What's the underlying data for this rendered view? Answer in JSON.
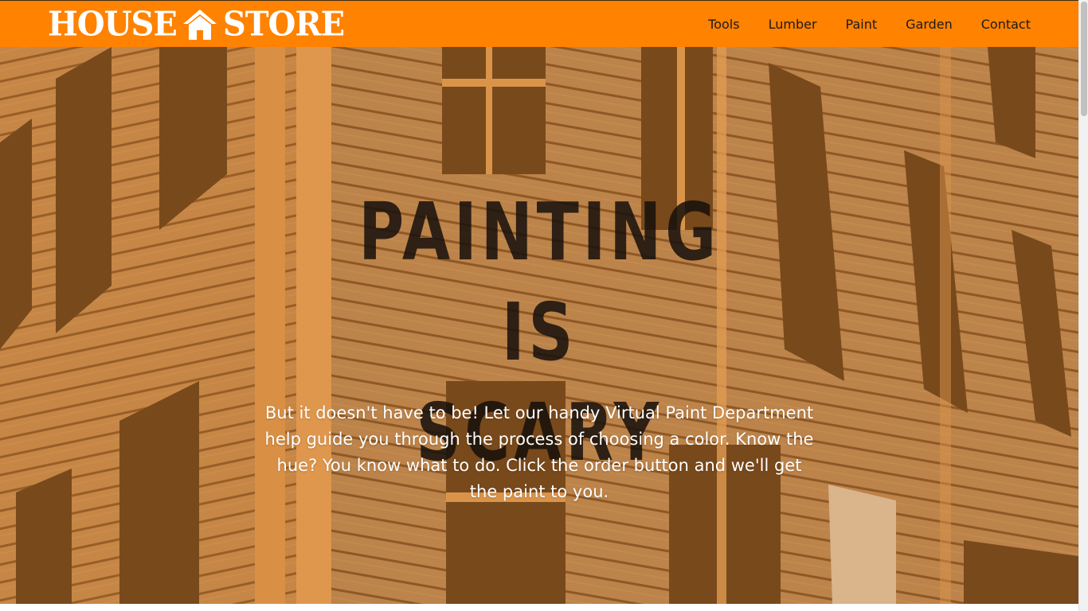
{
  "header": {
    "logo_left": "HOUSE",
    "logo_right": "STORE",
    "logo_icon": "house-icon",
    "background_color": "#ff8200",
    "nav": [
      {
        "label": "Tools"
      },
      {
        "label": "Lumber"
      },
      {
        "label": "Paint"
      },
      {
        "label": "Garden"
      },
      {
        "label": "Contact"
      }
    ]
  },
  "hero": {
    "title_line1": "PAINTING IS",
    "title_line2": "SCARY",
    "body": "But it doesn't have to be! Let our handy Virtual Paint Department help guide you through the process of choosing a color. Know the hue? You know what to do. Click the order button and we'll get the paint to you.",
    "overlay_color": "#de8228"
  }
}
